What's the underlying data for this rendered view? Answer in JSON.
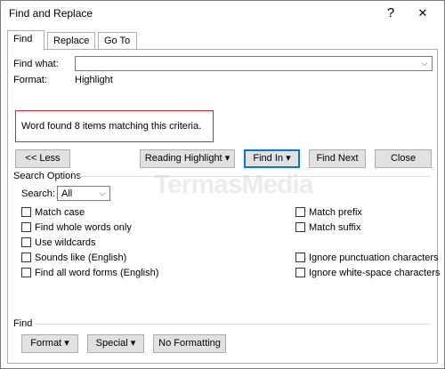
{
  "window": {
    "title": "Find and Replace",
    "help_glyph": "?",
    "close_glyph": "✕"
  },
  "tabs": [
    {
      "label": "Find",
      "active": true
    },
    {
      "label": "Replace",
      "active": false
    },
    {
      "label": "Go To",
      "active": false
    }
  ],
  "find": {
    "find_what_label": "Find what:",
    "find_what_value": "",
    "format_label": "Format:",
    "format_value": "Highlight"
  },
  "message": "Word found 8 items matching this criteria.",
  "buttons": {
    "less": "<< Less",
    "reading_highlight": "Reading Highlight",
    "find_in": "Find In",
    "find_next": "Find Next",
    "close": "Close",
    "format": "Format",
    "special": "Special",
    "no_formatting": "No Formatting"
  },
  "search_options": {
    "heading": "Search Options",
    "search_label": "Search:",
    "search_value": "All",
    "left": [
      {
        "label": "Match case",
        "checked": false
      },
      {
        "label": "Find whole words only",
        "checked": false
      },
      {
        "label": "Use wildcards",
        "checked": false
      },
      {
        "label": "Sounds like (English)",
        "checked": false
      },
      {
        "label": "Find all word forms (English)",
        "checked": false
      }
    ],
    "right": [
      {
        "label": "Match prefix",
        "checked": false
      },
      {
        "label": "Match suffix",
        "checked": false
      },
      {
        "label": "Ignore punctuation characters",
        "checked": false
      },
      {
        "label": "Ignore white-space characters",
        "checked": false
      }
    ]
  },
  "find_section_label": "Find",
  "watermark": "TermasMedia",
  "colors": {
    "message_border": "#d9232a",
    "focus_border": "#0078d7"
  }
}
